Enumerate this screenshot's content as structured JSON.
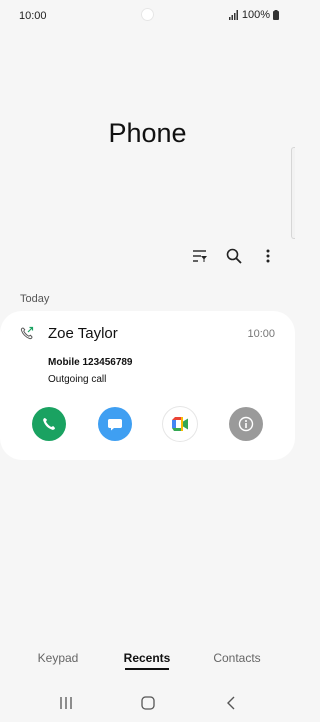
{
  "status_bar": {
    "time": "10:00",
    "battery": "100%"
  },
  "header": {
    "title": "Phone"
  },
  "toolbar": {
    "icons": [
      "filter-icon",
      "search-icon",
      "more-vertical-icon"
    ]
  },
  "recents": {
    "section_label": "Today",
    "items": [
      {
        "name": "Zoe Taylor",
        "time": "10:00",
        "number": "Mobile 123456789",
        "status": "Outgoing call",
        "type_icon": "outgoing-call-icon"
      }
    ],
    "actions": [
      "call-icon",
      "message-icon",
      "video-call-icon",
      "info-icon"
    ],
    "colors": {
      "call": "#1aa261",
      "message": "#3f9ff2",
      "info": "#9a9a9a"
    }
  },
  "bottom_nav": {
    "tabs": [
      "Keypad",
      "Recents",
      "Contacts"
    ],
    "active": "Recents"
  },
  "system_nav": {
    "icons": [
      "recent-apps-icon",
      "home-icon",
      "back-icon"
    ]
  }
}
